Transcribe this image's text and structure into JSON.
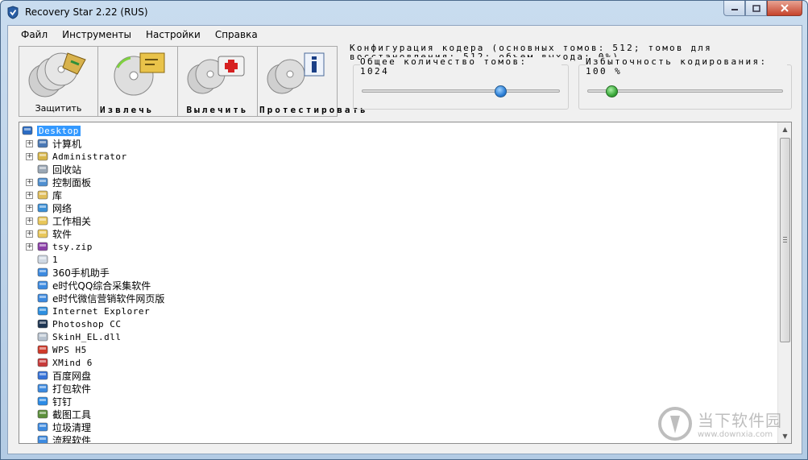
{
  "window": {
    "title": "Recovery Star 2.22 (RUS)"
  },
  "menu": [
    "Файл",
    "Инструменты",
    "Настройки",
    "Справка"
  ],
  "toolbar": {
    "protect": "Защитить",
    "extract": "Извлечь",
    "heal": "Вылечить",
    "test": "Протестировать"
  },
  "config": {
    "title": "Конфигурация кодера (основных томов: 512; томов для восстановления: 512; объем выхода: 0%)",
    "total_volumes_label": "Общее количество томов: 1024",
    "redundancy_label": "Избыточность кодирования: 100 %",
    "total_volumes_slider": 0.7,
    "redundancy_slider": 0.12
  },
  "tree": [
    {
      "label": "Desktop",
      "icon": "desktop-icon",
      "expander": false,
      "indent": 0,
      "selected": true
    },
    {
      "label": "计算机",
      "icon": "computer-icon",
      "expander": true,
      "indent": 1
    },
    {
      "label": "Administrator",
      "icon": "user-folder-icon",
      "expander": true,
      "indent": 1
    },
    {
      "label": "回收站",
      "icon": "recycle-bin-icon",
      "expander": false,
      "indent": 1
    },
    {
      "label": "控制面板",
      "icon": "control-panel-icon",
      "expander": true,
      "indent": 1
    },
    {
      "label": "库",
      "icon": "library-icon",
      "expander": true,
      "indent": 1
    },
    {
      "label": "网络",
      "icon": "network-icon",
      "expander": true,
      "indent": 1
    },
    {
      "label": "工作相关",
      "icon": "folder-icon",
      "expander": true,
      "indent": 1
    },
    {
      "label": "软件",
      "icon": "folder-icon",
      "expander": true,
      "indent": 1
    },
    {
      "label": "tsy.zip",
      "icon": "zip-icon",
      "expander": true,
      "indent": 1
    },
    {
      "label": "1",
      "icon": "shortcut-icon",
      "expander": false,
      "indent": 1
    },
    {
      "label": "360手机助手",
      "icon": "app-shortcut-icon",
      "expander": false,
      "indent": 1
    },
    {
      "label": "e时代QQ综合采集软件",
      "icon": "app-shortcut-icon",
      "expander": false,
      "indent": 1
    },
    {
      "label": "e时代微信营销软件网页版",
      "icon": "app-shortcut-icon",
      "expander": false,
      "indent": 1
    },
    {
      "label": "Internet Explorer",
      "icon": "ie-icon",
      "expander": false,
      "indent": 1
    },
    {
      "label": "Photoshop CC",
      "icon": "photoshop-icon",
      "expander": false,
      "indent": 1
    },
    {
      "label": "SkinH_EL.dll",
      "icon": "dll-icon",
      "expander": false,
      "indent": 1
    },
    {
      "label": "WPS H5",
      "icon": "wps-icon",
      "expander": false,
      "indent": 1
    },
    {
      "label": "XMind 6",
      "icon": "xmind-icon",
      "expander": false,
      "indent": 1
    },
    {
      "label": "百度网盘",
      "icon": "baidu-icon",
      "expander": false,
      "indent": 1
    },
    {
      "label": "打包软件",
      "icon": "app-shortcut-icon",
      "expander": false,
      "indent": 1
    },
    {
      "label": "钉钉",
      "icon": "dingtalk-icon",
      "expander": false,
      "indent": 1
    },
    {
      "label": "截图工具",
      "icon": "snipping-icon",
      "expander": false,
      "indent": 1
    },
    {
      "label": "垃圾清理",
      "icon": "app-shortcut-icon",
      "expander": false,
      "indent": 1
    },
    {
      "label": "流程软件",
      "icon": "app-shortcut-icon",
      "expander": false,
      "indent": 1
    }
  ],
  "watermark": {
    "name": "当下软件园",
    "url": "www.downxia.com"
  }
}
